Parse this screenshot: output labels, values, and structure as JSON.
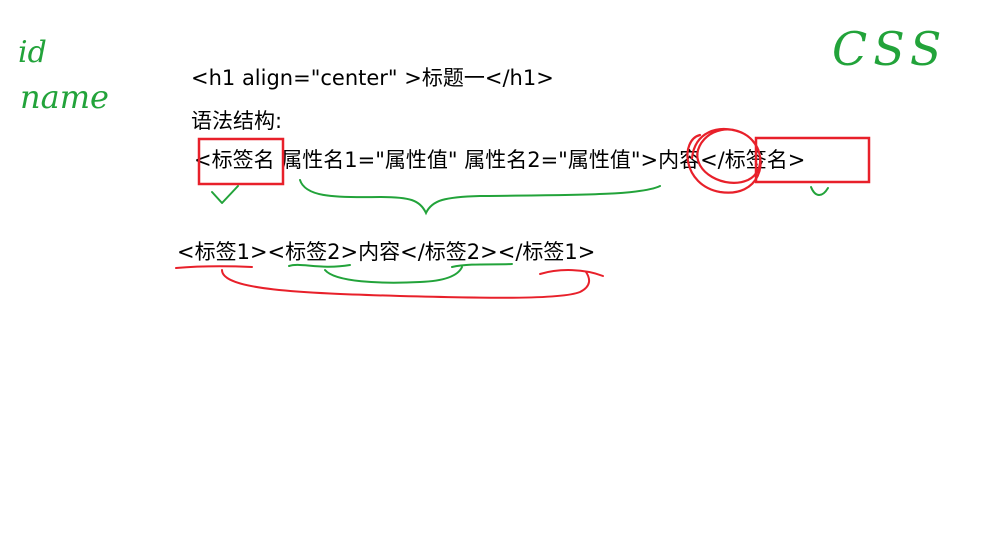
{
  "lines": {
    "h1_example": "<h1 align=\"center\" >标题一</h1>",
    "syntax_label": "语法结构:",
    "syntax_structure": "<标签名 属性名1=\"属性值\" 属性名2=\"属性值\">内容</标签名>",
    "nested_example": "<标签1><标签2>内容</标签2></标签1>"
  },
  "handwriting": {
    "left_note_line1": "id",
    "left_note_line2": "name",
    "right_note": "CSS"
  },
  "colors": {
    "red_ink": "#e8202a",
    "green_ink": "#22a33a",
    "text": "#000000"
  }
}
